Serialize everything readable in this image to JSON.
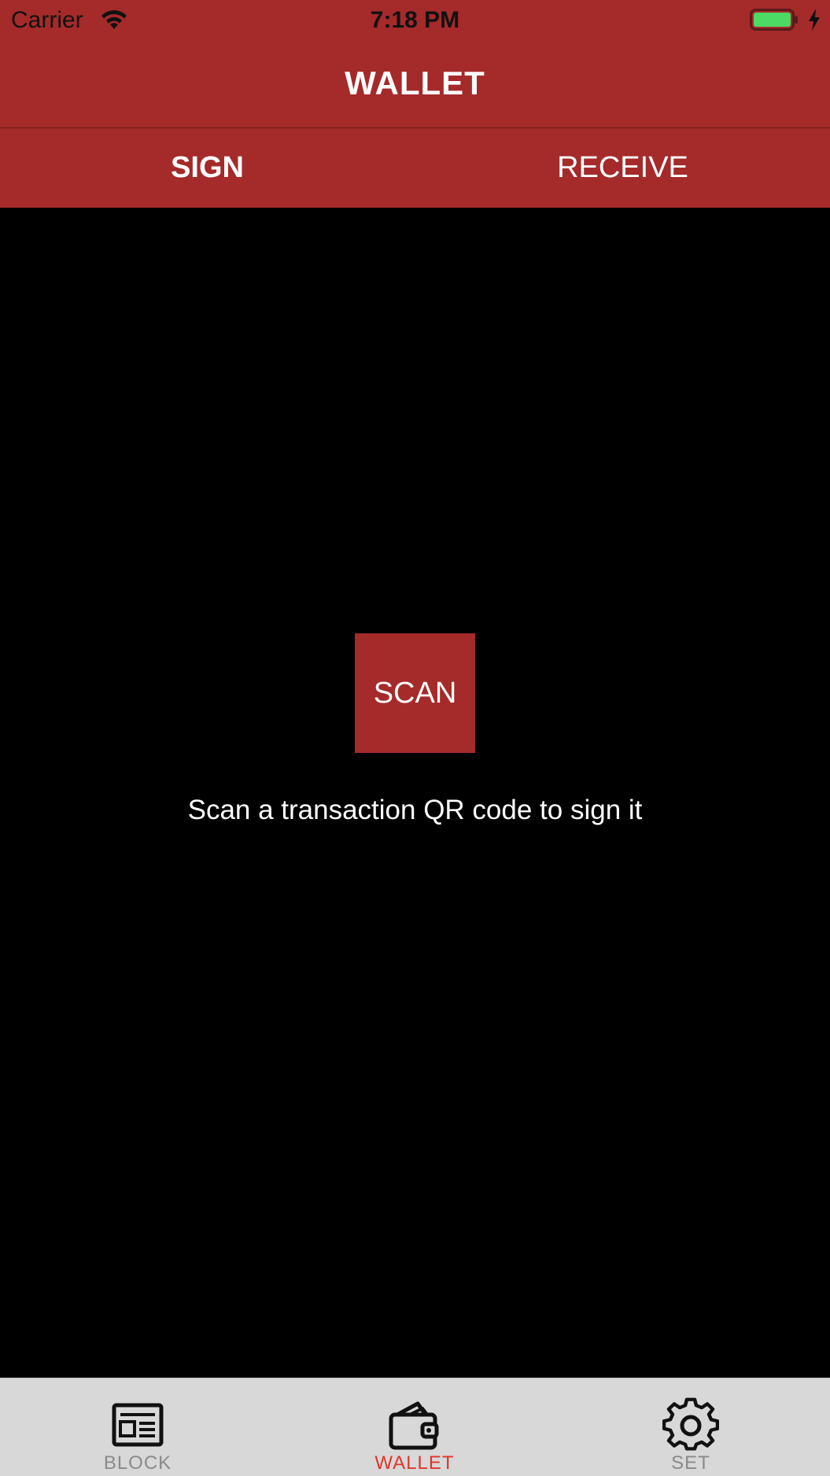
{
  "status_bar": {
    "carrier": "Carrier",
    "time": "7:18 PM",
    "wifi_icon": "wifi-icon",
    "battery_icon": "battery-icon",
    "charging_icon": "charging-bolt-icon",
    "battery_level": 1.0
  },
  "nav": {
    "title": "WALLET"
  },
  "tabs": [
    {
      "label": "SIGN",
      "active": true
    },
    {
      "label": "RECEIVE",
      "active": false
    }
  ],
  "main": {
    "scan_label": "SCAN",
    "hint": "Scan a transaction QR code to sign it"
  },
  "tabbar": {
    "items": [
      {
        "label": "BLOCK",
        "icon": "newspaper-icon",
        "active": false
      },
      {
        "label": "WALLET",
        "icon": "wallet-icon",
        "active": true
      },
      {
        "label": "SET",
        "icon": "gear-icon",
        "active": false
      }
    ]
  },
  "colors": {
    "brand": "#A52A2A",
    "background": "#000000",
    "tabbar_bg": "#D8D8D8",
    "tabbar_active": "#E0352B",
    "tabbar_inactive": "#8A8A8A",
    "battery_fill": "#4CD964"
  }
}
